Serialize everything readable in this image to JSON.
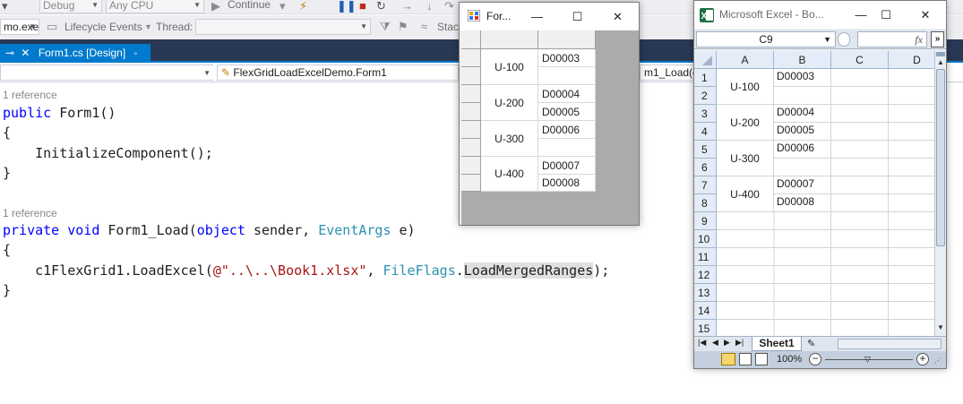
{
  "vs": {
    "toolbar": {
      "config_combo": "Debug",
      "platform_combo": "Any CPU",
      "continue_label": "Continue",
      "process_combo": "mo.exe",
      "lifecycle_label": "Lifecycle Events",
      "thread_label": "Thread:",
      "stack_label": "Stac"
    },
    "tabs": {
      "active": "Form1.cs [Design]"
    },
    "nav": {
      "class_combo": "FlexGridLoadExcelDemo.Form1",
      "member_combo": "m1_Load(o"
    },
    "code": {
      "ref1": "1 reference",
      "line1_kw": "public",
      "line1_rest": " Form1()",
      "open1": "{",
      "init": "    InitializeComponent();",
      "close1": "}",
      "ref2": "1 reference",
      "l2_kw1": "private",
      "l2_sp1": " ",
      "l2_kw2": "void",
      "l2_mid": " Form1_Load(",
      "l2_kw3": "object",
      "l2_mid2": " sender, ",
      "l2_type": "EventArgs",
      "l2_end": " e)",
      "open2": "{",
      "l3_start": "    c1FlexGrid1.LoadExcel(",
      "l3_str": "@\"..\\..\\Book1.xlsx\"",
      "l3_comma": ", ",
      "l3_type": "FileFlags",
      "l3_dot": ".",
      "l3_member": "LoadMergedRanges",
      "l3_end": ");",
      "close2": "}"
    }
  },
  "form": {
    "title": "For...",
    "grid": {
      "merged": [
        "U-100",
        "U-200",
        "U-300",
        "U-400"
      ],
      "col_b": [
        "D00003",
        "",
        "D00004",
        "D00005",
        "D00006",
        "",
        "D00007",
        "D00008"
      ]
    }
  },
  "excel": {
    "title": "Microsoft Excel - Bo...",
    "name_box": "C9",
    "fx": "fx",
    "columns": [
      "A",
      "B",
      "C",
      "D"
    ],
    "rows": [
      "1",
      "2",
      "3",
      "4",
      "5",
      "6",
      "7",
      "8",
      "9",
      "10",
      "11",
      "12",
      "13",
      "14",
      "15"
    ],
    "merged_a": [
      "U-100",
      "U-200",
      "U-300",
      "U-400"
    ],
    "col_b": [
      "D00003",
      "",
      "D00004",
      "D00005",
      "D00006",
      "",
      "D00007",
      "D00008"
    ],
    "sheet_tab": "Sheet1",
    "zoom": "100%"
  },
  "colors": {
    "vs_accent": "#007acc",
    "keyword": "#0000ff",
    "type": "#2b91af",
    "string": "#a31515",
    "excel_green": "#1d7044"
  }
}
